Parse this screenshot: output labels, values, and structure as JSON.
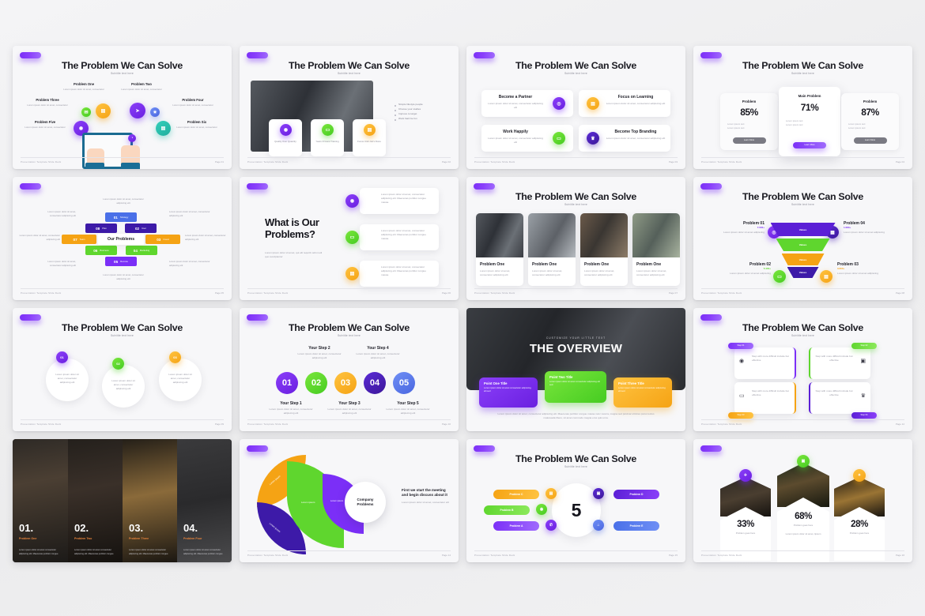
{
  "common": {
    "title": "The Problem We Can Solve",
    "subtitle": "Subtitle text here",
    "footer": "Presentation Template Slide Deck",
    "lorem_short": "Lorem ipsum dolor sit amet, consectetur adipiscing elit",
    "lorem_med": "Lorem ipsum dolor sit amet, consectetur adipiscing elit. Maecenas porttitor congue massa."
  },
  "slides": [
    {
      "id": "s1-radial-nodes",
      "title": "The Problem We Can Solve",
      "subtitle": "Subtitle text here",
      "page": "Page 01",
      "nodes": [
        {
          "label": "Problem One",
          "desc": "Lorem ipsum dolor sit amet, consectetur"
        },
        {
          "label": "Problem Two",
          "desc": "Lorem ipsum dolor sit amet, consectetur"
        },
        {
          "label": "Problem Three",
          "desc": "Lorem ipsum dolor sit amet, consectetur"
        },
        {
          "label": "Problem Four",
          "desc": "Lorem ipsum dolor sit amet, consectetur"
        },
        {
          "label": "Problem Five",
          "desc": "Lorem ipsum dolor sit amet, consectetur"
        },
        {
          "label": "Problem Six",
          "desc": "Lorem ipsum dolor sit amet, consectetur"
        }
      ],
      "icons": [
        "chat-icon",
        "calendar-icon",
        "send-icon",
        "gear-icon",
        "message-icon",
        "clipboard-icon"
      ]
    },
    {
      "id": "s2-photo-three-cards",
      "title": "The Problem We Can Solve",
      "subtitle": "Subtitle text here",
      "page": "Page 02",
      "cards": [
        {
          "label": "Quality Over Quantity",
          "icon": "chat-icon"
        },
        {
          "label": "Years Of Hard Training",
          "icon": "monitor-icon"
        },
        {
          "label": "Focus Until Job's Done",
          "icon": "clipboard-icon"
        }
      ],
      "bullets": [
        "Simple lifestyle people",
        "Choose your studies",
        "Improve to target",
        "Work hard be fun"
      ]
    },
    {
      "id": "s3-four-feature-cards",
      "title": "The Problem We Can Solve",
      "subtitle": "Subtitle text here",
      "page": "Page 03",
      "cards": [
        {
          "title": "Become a Partner",
          "desc": "Lorem ipsum dolor sit amet, consectetur adipiscing elit",
          "icon": "target-icon",
          "color": "vio"
        },
        {
          "title": "Focus on Learning",
          "desc": "Lorem ipsum dolor sit amet, consectetur adipiscing elit",
          "icon": "book-icon",
          "color": "amb"
        },
        {
          "title": "Work Happily",
          "desc": "Lorem ipsum dolor sit amet, consectetur adipiscing elit",
          "icon": "monitor-icon",
          "color": "grn"
        },
        {
          "title": "Become Top Branding",
          "desc": "Lorem ipsum dolor sit amet, consectetur adipiscing elit",
          "icon": "trophy-icon",
          "color": "dvi"
        }
      ]
    },
    {
      "id": "s4-percent-pricing-cards",
      "title": "The Problem We Can Solve",
      "subtitle": "Subtitle text here",
      "page": "Page 04",
      "cards": [
        {
          "header": "Problem",
          "value": "85%",
          "items": [
            "Lorem ipsum text",
            "Lorem ipsum text"
          ],
          "button": "Learn More",
          "featured": false
        },
        {
          "header": "Main Problem",
          "value": "71%",
          "items": [
            "Lorem ipsum text",
            "Lorem ipsum text"
          ],
          "button": "Learn More",
          "featured": true
        },
        {
          "header": "Problem",
          "value": "87%",
          "items": [
            "Lorem ipsum text",
            "Lorem ipsum text"
          ],
          "button": "Learn More",
          "featured": false
        }
      ]
    },
    {
      "id": "s5-gear-our-problems",
      "page": "Page 05",
      "center": "Our Problems",
      "segments": [
        {
          "num": "01",
          "label": "Strategy",
          "color": "#4a70e8"
        },
        {
          "num": "02",
          "label": "User",
          "color": "#3d1aa8"
        },
        {
          "num": "03",
          "label": "Invest",
          "color": "#f5a314"
        },
        {
          "num": "04",
          "label": "Marketing",
          "color": "#5fd62e"
        },
        {
          "num": "05",
          "label": "Remote",
          "color": "#7b2ff7"
        },
        {
          "num": "06",
          "label": "Business",
          "color": "#5fd62e"
        },
        {
          "num": "07",
          "label": "Team",
          "color": "#f5a314"
        },
        {
          "num": "08",
          "label": "Plan",
          "color": "#3d1aa8"
        }
      ],
      "side_notes": [
        "Lorem ipsum dolor sit amet, consectetur adipiscing elit",
        "Lorem ipsum dolor sit amet, consectetur adipiscing elit",
        "Lorem ipsum dolor sit amet, consectetur adipiscing elit",
        "Lorem ipsum dolor sit amet, consectetur adipiscing elit",
        "Lorem ipsum dolor sit amet, consectetur adipiscing elit",
        "Lorem ipsum dolor sit amet, consectetur adipiscing elit"
      ]
    },
    {
      "id": "s6-what-is-our-problems",
      "page": "Page 06",
      "heading_line1": "What is Our",
      "heading_line2": "Problems?",
      "lead": "Lorem ipsum dolor sit amet, qui elit requirit velit modi quo suscipiantur",
      "rows": [
        {
          "icon": "chat-icon",
          "color": "vio",
          "desc": "Lorem ipsum dolor sit amet, consectetur adipiscing elit. Maecenas porttitor congue massa."
        },
        {
          "icon": "monitor-icon",
          "color": "grn",
          "desc": "Lorem ipsum dolor sit amet, consectetur adipiscing elit. Maecenas porttitor congue massa."
        },
        {
          "icon": "clipboard-icon",
          "color": "amb",
          "desc": "Lorem ipsum dolor sit amet, consectetur adipiscing elit. Maecenas porttitor congue massa."
        }
      ]
    },
    {
      "id": "s7-photo-grid-four",
      "title": "The Problem We Can Solve",
      "subtitle": "Subtitle text here",
      "page": "Page 07",
      "cards": [
        {
          "title": "Problem One",
          "desc": "Lorem ipsum dolor sit amet, consectetur adipiscing elit"
        },
        {
          "title": "Problem One",
          "desc": "Lorem ipsum dolor sit amet, consectetur adipiscing elit"
        },
        {
          "title": "Problem One",
          "desc": "Lorem ipsum dolor sit amet, consectetur adipiscing elit"
        },
        {
          "title": "Problem One",
          "desc": "Lorem ipsum dolor sit amet, consectetur adipiscing elit"
        }
      ]
    },
    {
      "id": "s8-funnel",
      "title": "The Problem We Can Solve",
      "subtitle": "Subtitle text here",
      "page": "Page 08",
      "layers": [
        {
          "label": "Values",
          "color": "#5b1fd6"
        },
        {
          "label": "Values",
          "color": "#5fd62e"
        },
        {
          "label": "Values",
          "color": "#f5a314"
        },
        {
          "label": "Values",
          "color": "#3d1aa8"
        }
      ],
      "items": [
        {
          "title": "Problem 01",
          "value": "7.000+",
          "desc": "Lorem ipsum dolor sit amet adipiscing",
          "icon": "target-icon",
          "color": "vio"
        },
        {
          "title": "Problem 02",
          "value": "5.400+",
          "desc": "Lorem ipsum dolor sit amet adipiscing",
          "icon": "monitor-icon",
          "color": "grn"
        },
        {
          "title": "Problem 03",
          "value": "3.600+",
          "desc": "Lorem ipsum dolor sit amet adipiscing",
          "icon": "book-icon",
          "color": "amb"
        },
        {
          "title": "Problem 04",
          "value": "1.080+",
          "desc": "Lorem ipsum dolor sit amet adipiscing",
          "icon": "chart-icon",
          "color": "dvi"
        }
      ]
    },
    {
      "id": "s9-three-circles",
      "title": "The Problem We Can Solve",
      "subtitle": "Subtitle text here",
      "page": "Page 09",
      "circles": [
        {
          "num": "01",
          "color": "vio",
          "desc": "Lorem ipsum dolor sit amet, consectetur adipiscing elit"
        },
        {
          "num": "02",
          "color": "grn",
          "desc": "Lorem ipsum dolor sit amet, consectetur adipiscing elit"
        },
        {
          "num": "03",
          "color": "amb",
          "desc": "Lorem ipsum dolor sit amet, consectetur adipiscing elit"
        }
      ]
    },
    {
      "id": "s10-five-steps",
      "title": "The Problem We Can Solve",
      "subtitle": "Subtitle text here",
      "page": "Page 10",
      "steps": [
        {
          "num": "01",
          "label": "Your Step 1",
          "desc": "Lorem ipsum dolor sit amet, consectetur adipiscing elit",
          "color": "#7b2ff7",
          "pos": "bottom"
        },
        {
          "num": "02",
          "label": "Your Step 2",
          "desc": "Lorem ipsum dolor sit amet, consectetur adipiscing elit",
          "color": "#5fd62e",
          "pos": "top"
        },
        {
          "num": "03",
          "label": "Your Step 3",
          "desc": "Lorem ipsum dolor sit amet, consectetur adipiscing elit",
          "color": "#f5a314",
          "pos": "bottom"
        },
        {
          "num": "04",
          "label": "Your Step 4",
          "desc": "Lorem ipsum dolor sit amet, consectetur adipiscing elit",
          "color": "#3d1aa8",
          "pos": "top"
        },
        {
          "num": "05",
          "label": "Your Step 5",
          "desc": "Lorem ipsum dolor sit amet, consectetur adipiscing elit",
          "color": "#4a70e8",
          "pos": "bottom"
        }
      ]
    },
    {
      "id": "s11-overview",
      "page": "Page 11",
      "kicker": "CUSTOMIZE YOUR LITTLE TEXT",
      "title": "THE OVERVIEW",
      "cards": [
        {
          "title": "Point One Title",
          "desc": "Lorem ipsum dolor sit amet consectetur adipiscing elit sed",
          "color": "#7b2ff7"
        },
        {
          "title": "Point Two Title",
          "desc": "Lorem ipsum dolor sit amet consectetur adipiscing elit sed",
          "color": "#5fd62e"
        },
        {
          "title": "Point Three Title",
          "desc": "Lorem ipsum dolor sit amet consectetur adipiscing elit sed",
          "color": "#f5a314"
        }
      ],
      "body": "Lorem ipsum dolor sit amet, consectetur adipiscing elit. Maecenas porttitor congue massa nunc viverra, magna sed pulvinar ultricies purus lectus malesuada libero, sit amet commodo magna eros quis urna."
    },
    {
      "id": "s12-step-cards-grid",
      "title": "The Problem We Can Solve",
      "subtitle": "Subtitle text here",
      "page": "Page 12",
      "cards": [
        {
          "badge": "Step 01",
          "desc": "Step with more difficult include but effective",
          "icon": "chat-icon",
          "color": "#7b2ff7",
          "badge_pos": "top-left"
        },
        {
          "badge": "Step 02",
          "desc": "Step with more difficult include but effective",
          "icon": "image-icon",
          "color": "#5fd62e",
          "badge_pos": "top-right"
        },
        {
          "badge": "Step 03",
          "desc": "Step with more difficult include but effective",
          "icon": "monitor-icon",
          "color": "#f5a314",
          "badge_pos": "bottom-left"
        },
        {
          "badge": "Step 04",
          "desc": "Step with more difficult include but effective",
          "icon": "trophy-icon",
          "color": "#5b1fd6",
          "badge_pos": "bottom-right"
        }
      ]
    },
    {
      "id": "s13-four-photo-panels",
      "panels": [
        {
          "num": "01.",
          "title": "Problem One",
          "desc": "Lorem ipsum dolor sit amet consectetur adipiscing elit. Maecenas porttitor congue"
        },
        {
          "num": "02.",
          "title": "Problem Two",
          "desc": "Lorem ipsum dolor sit amet consectetur adipiscing elit. Maecenas porttitor congue"
        },
        {
          "num": "03.",
          "title": "Problem Three",
          "desc": "Lorem ipsum dolor sit amet consectetur adipiscing elit. Maecenas porttitor congue"
        },
        {
          "num": "04.",
          "title": "Problem Four",
          "desc": "Lorem ipsum dolor sit amet consectetur adipiscing elit. Maecenas porttitor congue"
        }
      ]
    },
    {
      "id": "s14-petals-company-problems",
      "page": "Page 14",
      "center": "Company Problems",
      "petals": [
        {
          "label": "Lorem ipsum",
          "color": "#f5a314"
        },
        {
          "label": "Lorem ipsum",
          "color": "#3d1aa8"
        },
        {
          "label": "Lorem ipsum",
          "color": "#5fd62e"
        },
        {
          "label": "Lorem ipsum",
          "color": "#7b2ff7"
        }
      ],
      "side_title": "First we start the meeting and begin discuss about it",
      "side_desc": "Lorem ipsum dolor sit amet, consectetur elit"
    },
    {
      "id": "s15-problems-a-to-e",
      "title": "The Problem We Can Solve",
      "subtitle": "Subtitle text here",
      "page": "Page 15",
      "center": "5",
      "items": [
        {
          "label": "Problem C",
          "color": "#f5a314",
          "icon": "calendar-icon",
          "side": "left"
        },
        {
          "label": "Problem B",
          "color": "#5fd62e",
          "icon": "chat-icon",
          "side": "left"
        },
        {
          "label": "Problem A",
          "color": "#7b2ff7",
          "icon": "phone-icon",
          "side": "left"
        },
        {
          "label": "Problem D",
          "color": "#5b1fd6",
          "icon": "image-icon",
          "side": "right"
        },
        {
          "label": "Problem E",
          "color": "#4a70e8",
          "icon": "lock-icon",
          "side": "right"
        }
      ]
    },
    {
      "id": "s16-percent-arrow-cards",
      "page": "Page 16",
      "cards": [
        {
          "pct": "33%",
          "caption": "Problem goes here",
          "icon": "rocket-icon",
          "color": "vio"
        },
        {
          "pct": "68%",
          "caption": "Problem goes here",
          "sub": "Lorem ipsum dolor sit amet, lipsum",
          "icon": "image-icon",
          "color": "grn"
        },
        {
          "pct": "28%",
          "caption": "Problem goes here",
          "icon": "bulb-icon",
          "color": "amb"
        }
      ]
    }
  ]
}
